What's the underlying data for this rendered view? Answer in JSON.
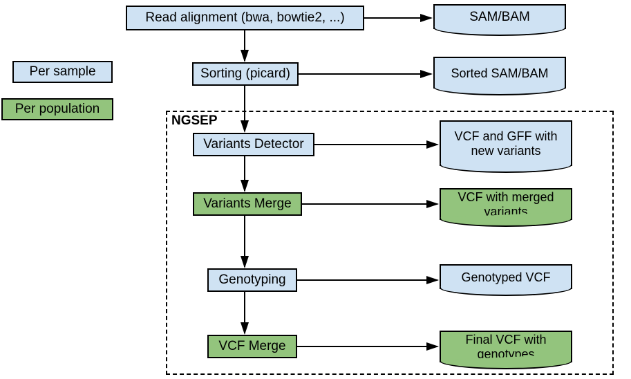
{
  "legend": {
    "per_sample": "Per sample",
    "per_population": "Per population"
  },
  "group_label": "NGSEP",
  "steps": {
    "read_alignment": "Read alignment (bwa, bowtie2, ...)",
    "sorting": "Sorting (picard)",
    "variants_detector": "Variants Detector",
    "variants_merge": "Variants Merge",
    "genotyping": "Genotyping",
    "vcf_merge": "VCF Merge"
  },
  "outputs": {
    "sam_bam": "SAM/BAM",
    "sorted_sam_bam": "Sorted SAM/BAM",
    "vcf_gff_new": "VCF and GFF with new variants",
    "vcf_merged": "VCF with merged variants",
    "genotyped_vcf": "Genotyped VCF",
    "final_vcf": "Final VCF with genotypes"
  },
  "colors": {
    "per_sample": "#cfe2f3",
    "per_population": "#93c47d"
  }
}
